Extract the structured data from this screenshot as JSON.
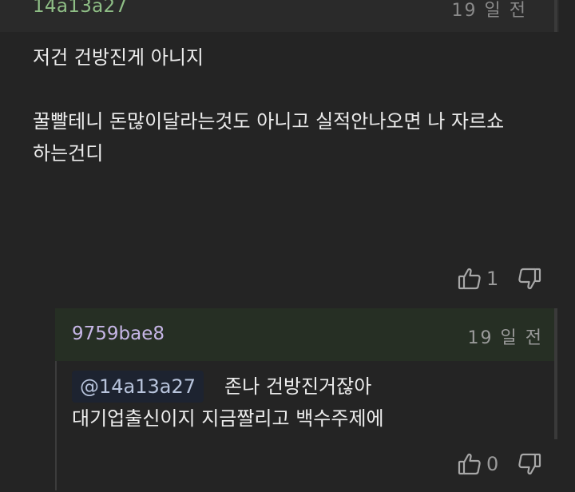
{
  "parent_comment": {
    "author": "14a13a27",
    "time": "19 일 전",
    "lines": [
      "저건 건방진게 아니지",
      "꿀빨테니 돈많이달라는것도 아니고 실적안나오면 나 자르쇼",
      "하는건디"
    ],
    "likes": "1"
  },
  "reply": {
    "author": "9759bae8",
    "time": "19 일 전",
    "mention": "@14a13a27",
    "line1": "존나 건방진거잖아",
    "line2": "대기업출신이지 지금짤리고 백수주제에",
    "likes": "0"
  },
  "icons": {
    "like": "thumbs-up-icon",
    "dislike": "thumbs-down-icon"
  },
  "colors": {
    "background": "#242424",
    "parent_author": "#8fbf86",
    "reply_author": "#c6b6e6",
    "reply_header_bg": "#262f24",
    "mention_bg": "#1d2330"
  }
}
